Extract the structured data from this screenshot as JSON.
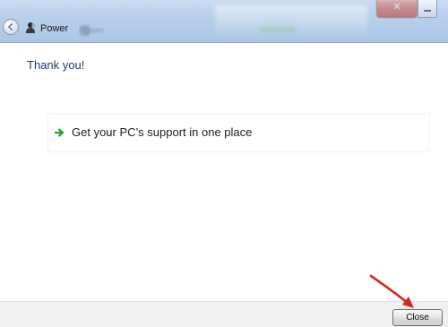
{
  "titlebar": {
    "app_title": "Power",
    "ghost_text": "Power",
    "back_icon": "back-arrow-icon",
    "app_icon": "power-troubleshooter-icon",
    "close_label": "✕"
  },
  "main": {
    "heading": "Thank you!",
    "link_text": "Get your PC’s support in one place",
    "link_icon": "green-arrow-icon"
  },
  "footer": {
    "close_label": "Close"
  },
  "colors": {
    "heading": "#1e3a6e",
    "link_arrow": "#2aa12a",
    "annotation_arrow": "#d42a1e"
  }
}
